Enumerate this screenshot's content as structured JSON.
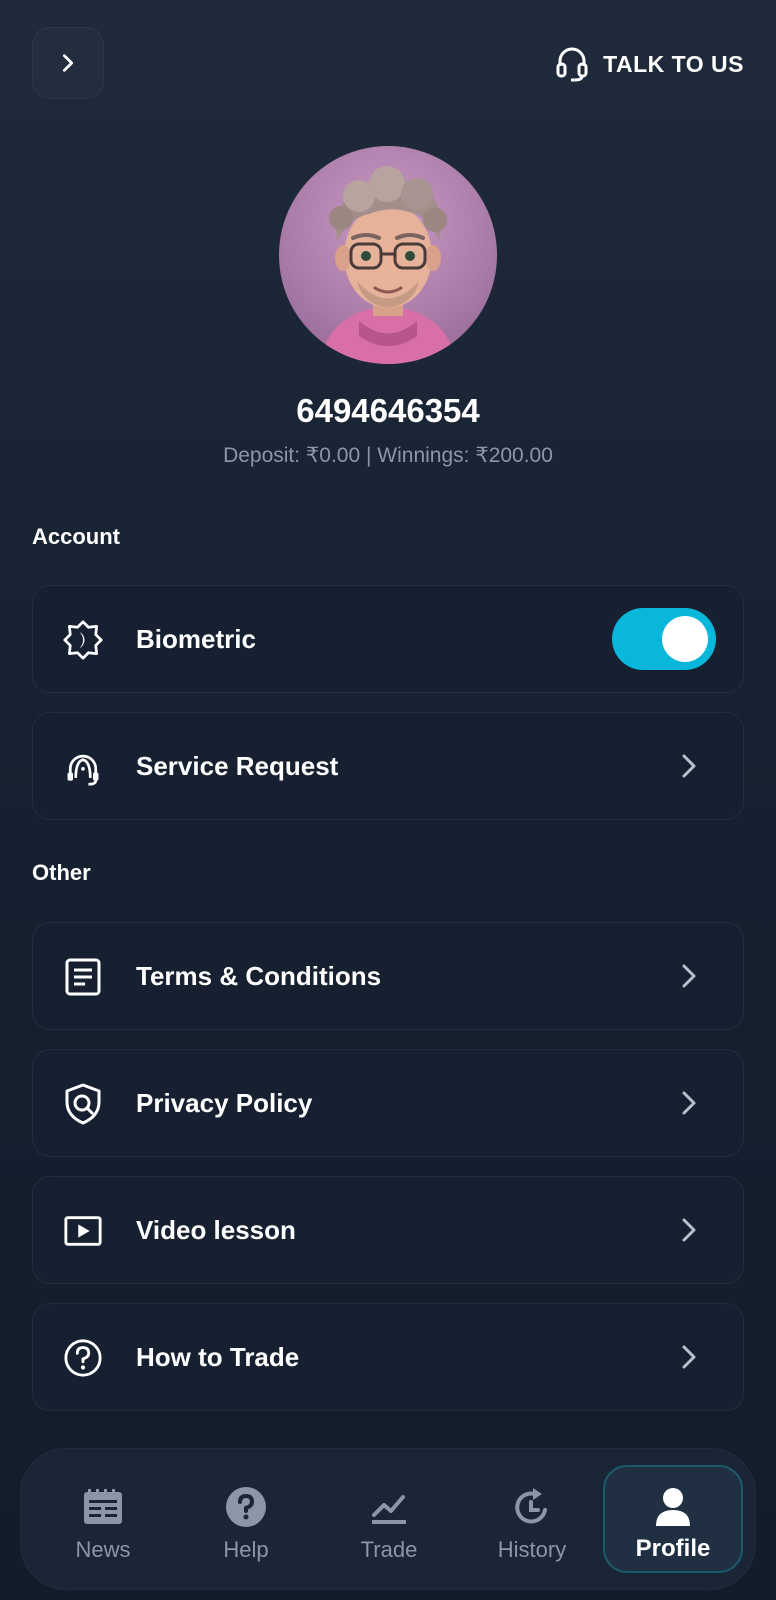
{
  "header": {
    "back_icon": "chevron-right-icon",
    "talk_label": "TALK TO US",
    "talk_icon": "headset-icon"
  },
  "profile": {
    "avatar": "avatar-image",
    "username": "6494646354",
    "balance": "Deposit: ₹0.00 | Winnings: ₹200.00"
  },
  "account": {
    "title": "Account",
    "items": [
      {
        "label": "Biometric",
        "icon": "biometric-icon",
        "toggle_on": true
      },
      {
        "label": "Service Request",
        "icon": "support-agent-icon"
      }
    ]
  },
  "other": {
    "title": "Other",
    "items": [
      {
        "label": "Terms & Conditions",
        "icon": "document-icon"
      },
      {
        "label": "Privacy Policy",
        "icon": "shield-icon"
      },
      {
        "label": "Video lesson",
        "icon": "video-icon"
      },
      {
        "label": "How to Trade",
        "icon": "question-icon"
      }
    ]
  },
  "nav": {
    "items": [
      {
        "label": "News",
        "icon": "news-icon"
      },
      {
        "label": "Help",
        "icon": "help-icon"
      },
      {
        "label": "Trade",
        "icon": "trade-icon"
      },
      {
        "label": "History",
        "icon": "history-icon"
      },
      {
        "label": "Profile",
        "icon": "profile-icon",
        "active": true
      }
    ]
  },
  "colors": {
    "background": "#172131",
    "card": "#172030",
    "accent": "#08b7d9",
    "muted_text": "#8b96a8"
  }
}
